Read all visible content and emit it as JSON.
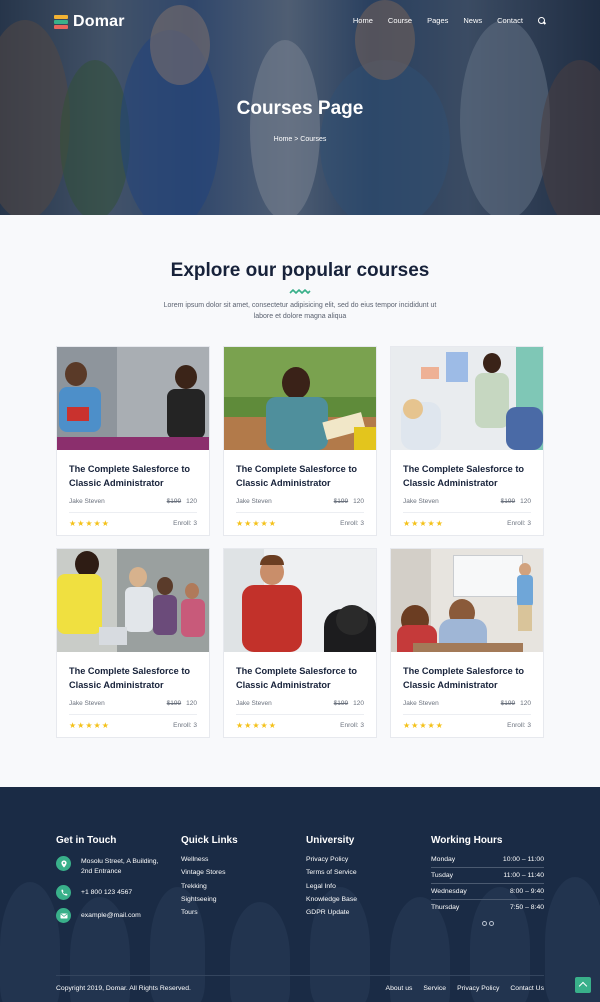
{
  "brand": {
    "name": "Domar",
    "accent": "#39b08a",
    "star_color": "#f4c119"
  },
  "nav": {
    "items": [
      "Home",
      "Course",
      "Pages",
      "News",
      "Contact"
    ],
    "search_icon": "search-icon"
  },
  "hero": {
    "title": "Courses Page",
    "breadcrumb": "Home > Courses"
  },
  "courses_section": {
    "title": "Explore our popular courses",
    "subtitle": "Lorem ipsum dolor sit amet, consectetur adipisicing elit, sed do eius tempor incididunt ut labore et dolore magna aliqua"
  },
  "courses": [
    {
      "title": "The Complete Salesforce to Classic Administrator",
      "author": "Jake Steven",
      "old_price": "$199",
      "price": "120",
      "rating": 5,
      "stars": "★★★★★",
      "enroll": "Enroll: 3"
    },
    {
      "title": "The Complete Salesforce to Classic Administrator",
      "author": "Jake Steven",
      "old_price": "$199",
      "price": "120",
      "rating": 5,
      "stars": "★★★★★",
      "enroll": "Enroll: 3"
    },
    {
      "title": "The Complete Salesforce to Classic Administrator",
      "author": "Jake Steven",
      "old_price": "$199",
      "price": "120",
      "rating": 5,
      "stars": "★★★★★",
      "enroll": "Enroll: 3"
    },
    {
      "title": "The Complete Salesforce to Classic Administrator",
      "author": "Jake Steven",
      "old_price": "$199",
      "price": "120",
      "rating": 5,
      "stars": "★★★★★",
      "enroll": "Enroll: 3"
    },
    {
      "title": "The Complete Salesforce to Classic Administrator",
      "author": "Jake Steven",
      "old_price": "$199",
      "price": "120",
      "rating": 5,
      "stars": "★★★★★",
      "enroll": "Enroll: 3"
    },
    {
      "title": "The Complete Salesforce to Classic Administrator",
      "author": "Jake Steven",
      "old_price": "$199",
      "price": "120",
      "rating": 5,
      "stars": "★★★★★",
      "enroll": "Enroll: 3"
    }
  ],
  "footer": {
    "contact": {
      "heading": "Get in Touch",
      "address": "Mosolu Street, A Building, 2nd Entrance",
      "phone": "+1 800 123 4567",
      "email": "example@mail.com"
    },
    "quick_links": {
      "heading": "Quick Links",
      "items": [
        "Wellness",
        "Vintage Stores",
        "Trekking",
        "Sightseeing",
        "Tours"
      ]
    },
    "university": {
      "heading": "University",
      "items": [
        "Privacy Policy",
        "Terms of Service",
        "Legal Info",
        "Knowledge Base",
        "GDPR Update"
      ]
    },
    "hours": {
      "heading": "Working Hours",
      "rows": [
        {
          "day": "Monday",
          "time": "10:00 – 11:00"
        },
        {
          "day": "Tusday",
          "time": "11:00 – 11:40"
        },
        {
          "day": "Wednesday",
          "time": "8:00 – 9:40"
        },
        {
          "day": "Thursday",
          "time": "7:50 – 8:40"
        }
      ]
    },
    "copyright": "Copyright 2019, Domar. All Rights Reserved.",
    "bottom_links": [
      "About us",
      "Service",
      "Privacy Policy",
      "Contact Us"
    ]
  }
}
